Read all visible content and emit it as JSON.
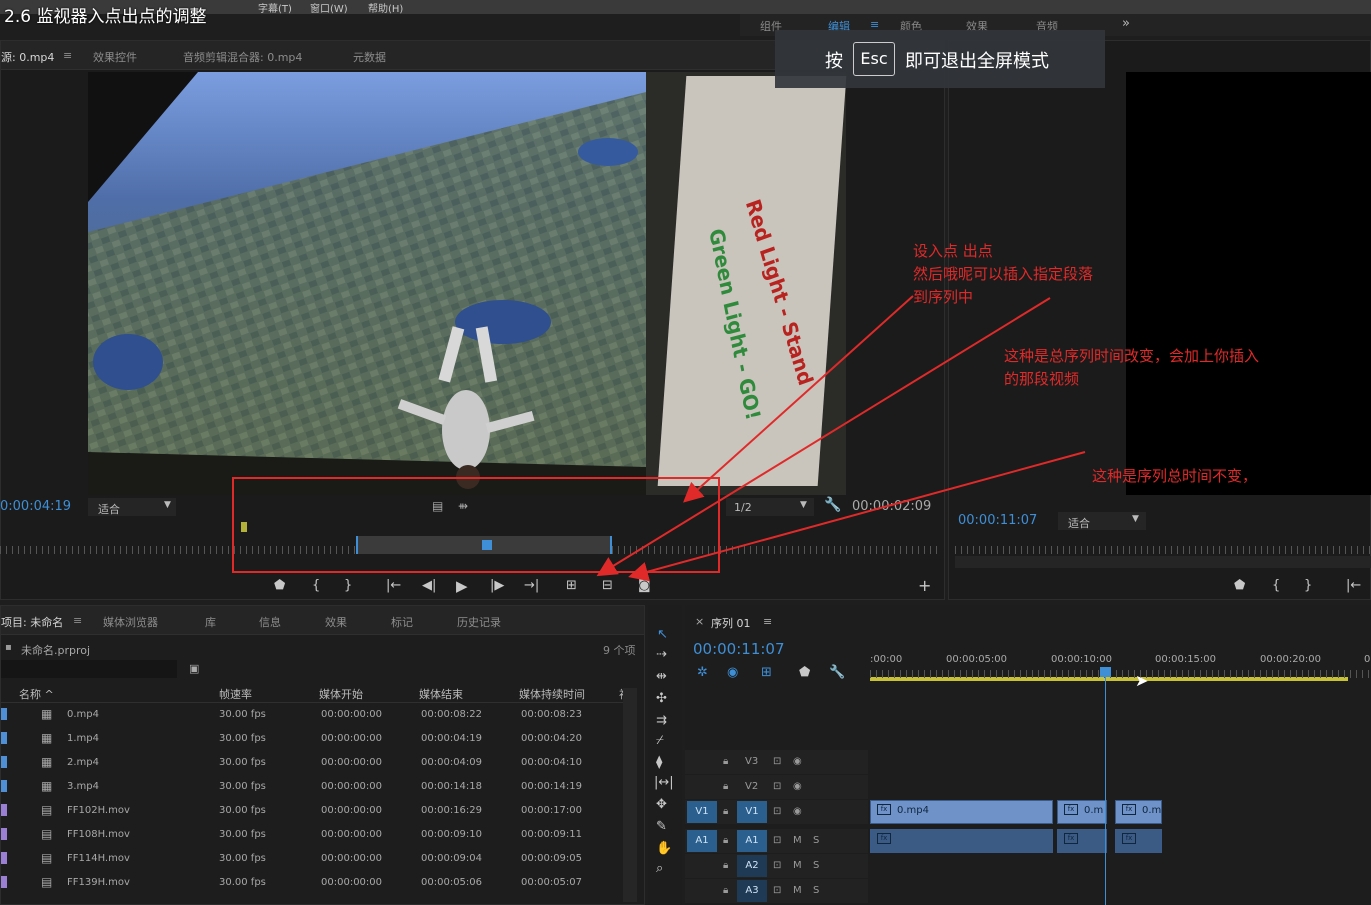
{
  "lesson_title": "2.6 监视器入点出点的调整",
  "menubar": {
    "items": [
      "字幕(T)",
      "窗口(W)",
      "帮助(H)"
    ]
  },
  "workspace_tabs": [
    "组件",
    "编辑",
    "≡",
    "颜色",
    "效果",
    "音频",
    "»"
  ],
  "fullscreen_hint": {
    "prefix": "按",
    "key": "Esc",
    "suffix": "即可退出全屏模式"
  },
  "source_monitor": {
    "tabs": [
      "源: 0.mp4",
      "≡",
      "效果控件",
      "音频剪辑混合器: 0.mp4",
      "元数据"
    ],
    "timecode_in": "0:00:04:19",
    "fit": "适合",
    "resolution": "1/2",
    "timecode_duration": "00:00:02:09",
    "video_text": [
      "Red Light - Stand",
      "Green Light - GO!"
    ]
  },
  "program_monitor": {
    "timecode": "00:00:11:07",
    "fit": "适合"
  },
  "annotations": {
    "a1": [
      "设入点 出点",
      "然后哦呢可以插入指定段落",
      "到序列中"
    ],
    "a2": [
      "这种是总序列时间改变，会加上你插入",
      "的那段视频"
    ],
    "a3": [
      "这种是序列总时间不变，"
    ]
  },
  "project": {
    "tabs": [
      "项目: 未命名",
      "≡",
      "媒体浏览器",
      "库",
      "信息",
      "效果",
      "标记",
      "历史记录"
    ],
    "file": "未命名.prproj",
    "count": "9 个项",
    "columns": [
      "名称 ^",
      "帧速率",
      "媒体开始",
      "媒体结束",
      "媒体持续时间",
      "视"
    ],
    "rows": [
      {
        "name": "0.mp4",
        "fps": "30.00 fps",
        "start": "00:00:00:00",
        "end": "00:00:08:22",
        "dur": "00:00:08:23",
        "color": "#4e8fd6"
      },
      {
        "name": "1.mp4",
        "fps": "30.00 fps",
        "start": "00:00:00:00",
        "end": "00:00:04:19",
        "dur": "00:00:04:20",
        "color": "#4e8fd6"
      },
      {
        "name": "2.mp4",
        "fps": "30.00 fps",
        "start": "00:00:00:00",
        "end": "00:00:04:09",
        "dur": "00:00:04:10",
        "color": "#4e8fd6"
      },
      {
        "name": "3.mp4",
        "fps": "30.00 fps",
        "start": "00:00:00:00",
        "end": "00:00:14:18",
        "dur": "00:00:14:19",
        "color": "#4e8fd6"
      },
      {
        "name": "FF102H.mov",
        "fps": "30.00 fps",
        "start": "00:00:00:00",
        "end": "00:00:16:29",
        "dur": "00:00:17:00",
        "color": "#9b7fd4"
      },
      {
        "name": "FF108H.mov",
        "fps": "30.00 fps",
        "start": "00:00:00:00",
        "end": "00:00:09:10",
        "dur": "00:00:09:11",
        "color": "#9b7fd4"
      },
      {
        "name": "FF114H.mov",
        "fps": "30.00 fps",
        "start": "00:00:00:00",
        "end": "00:00:09:04",
        "dur": "00:00:09:05",
        "color": "#9b7fd4"
      },
      {
        "name": "FF139H.mov",
        "fps": "30.00 fps",
        "start": "00:00:00:00",
        "end": "00:00:05:06",
        "dur": "00:00:05:07",
        "color": "#9b7fd4"
      }
    ]
  },
  "timeline": {
    "tab": "序列 01",
    "menu": "≡",
    "close": "×",
    "timecode": "00:00:11:07",
    "ruler": [
      ":00:00",
      "00:00:05:00",
      "00:00:10:00",
      "00:00:15:00",
      "00:00:20:00",
      "0"
    ],
    "tracks": [
      "V3",
      "V2",
      "V1",
      "A1",
      "A2",
      "A3"
    ],
    "src_tracks": [
      "V1",
      "A1"
    ],
    "clip_names": [
      "0.mp4",
      "0.m",
      "0.m"
    ]
  },
  "colors": {
    "accent": "#3f8fd6",
    "annotation": "#e02a2a",
    "clip_video": "#6f93c8",
    "clip_audio": "#3b5b85"
  }
}
